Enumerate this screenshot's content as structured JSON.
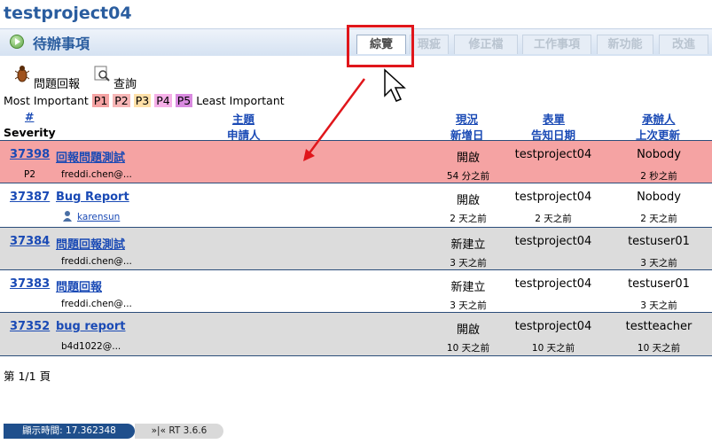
{
  "project_title": "testproject04",
  "section_title": "待辦事項",
  "tabs": [
    {
      "label": "綜覽",
      "active": true
    },
    {
      "label": "瑕疵",
      "active": false
    },
    {
      "label": "修正檔",
      "active": false
    },
    {
      "label": "工作事項",
      "active": false
    },
    {
      "label": "新功能",
      "active": false
    },
    {
      "label": "改進",
      "active": false
    }
  ],
  "toolbar": {
    "report_label": "問題回報",
    "query_label": "查詢"
  },
  "legend": {
    "most": "Most Important",
    "least": "Least Important",
    "levels": [
      "P1",
      "P2",
      "P3",
      "P4",
      "P5"
    ],
    "colors": [
      "#f5a3a3",
      "#f7b6b6",
      "#ffe0a8",
      "#f6b0e8",
      "#d98ae0"
    ]
  },
  "headers": {
    "hash": "#",
    "severity": "Severity",
    "subject": "主題",
    "requestor": "申請人",
    "status": "現況",
    "created": "新增日",
    "queue": "表單",
    "told": "告知日期",
    "owner": "承辦人",
    "updated": "上次更新"
  },
  "tickets": [
    {
      "id": "37398",
      "subject": "回報問題測試",
      "priority": "P2",
      "requestor": "freddi.chen@...",
      "status": "開啟",
      "created": "54 分之前",
      "queue": "testproject04",
      "told": "",
      "owner": "Nobody",
      "updated": "2 秒之前"
    },
    {
      "id": "37387",
      "subject": "Bug Report",
      "priority": "",
      "requestor": "karensun",
      "status": "開啟",
      "created": "2 天之前",
      "queue": "testproject04",
      "told": "2 天之前",
      "owner": "Nobody",
      "updated": "2 天之前"
    },
    {
      "id": "37384",
      "subject": "問題回報測試",
      "priority": "",
      "requestor": "freddi.chen@...",
      "status": "新建立",
      "created": "3 天之前",
      "queue": "testproject04",
      "told": "",
      "owner": "testuser01",
      "updated": "3 天之前"
    },
    {
      "id": "37383",
      "subject": "問題回報",
      "priority": "",
      "requestor": "freddi.chen@...",
      "status": "新建立",
      "created": "3 天之前",
      "queue": "testproject04",
      "told": "",
      "owner": "testuser01",
      "updated": "3 天之前"
    },
    {
      "id": "37352",
      "subject": "bug report",
      "priority": "",
      "requestor": "b4d1022@...",
      "status": "開啟",
      "created": "10 天之前",
      "queue": "testproject04",
      "told": "10 天之前",
      "owner": "testteacher",
      "updated": "10 天之前"
    }
  ],
  "pager": "第 1/1 頁",
  "footer": {
    "time": "顯示時間: 17.362348",
    "version": "»|« RT 3.6.6"
  }
}
